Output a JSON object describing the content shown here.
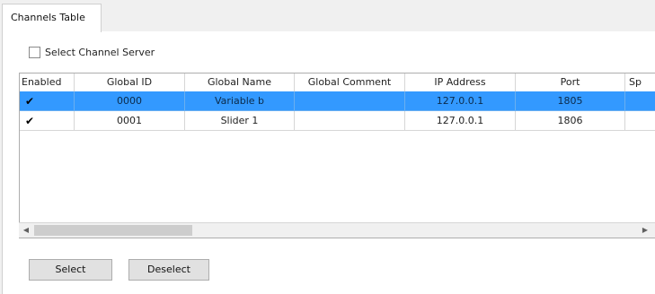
{
  "tab": {
    "label": "Channels Table"
  },
  "select_channel_server": {
    "label": "Select Channel Server",
    "checked": false
  },
  "table": {
    "columns": [
      "Enabled",
      "Global ID",
      "Global Name",
      "Global Comment",
      "IP Address",
      "Port",
      "Sp"
    ],
    "rows": [
      {
        "enabled": true,
        "global_id": "0000",
        "global_name": "Variable b",
        "global_comment": "",
        "ip": "127.0.0.1",
        "port": "1805",
        "sp": "",
        "selected": true
      },
      {
        "enabled": true,
        "global_id": "0001",
        "global_name": "Slider 1",
        "global_comment": "",
        "ip": "127.0.0.1",
        "port": "1806",
        "sp": "",
        "selected": false
      }
    ]
  },
  "buttons": {
    "select": "Select",
    "deselect": "Deselect"
  },
  "icons": {
    "check": "check-icon",
    "scroll_left": "scroll-left-icon",
    "scroll_right": "scroll-right-icon"
  },
  "colors": {
    "selection": "#3399ff"
  }
}
